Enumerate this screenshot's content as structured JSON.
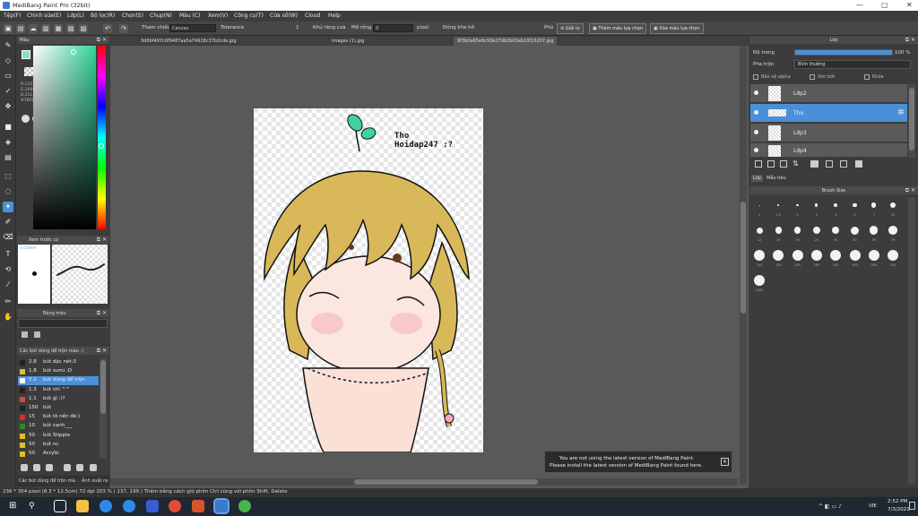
{
  "window": {
    "title": "MediBang Paint Pro (32bit)"
  },
  "menu": [
    "Tệp(F)",
    "Chỉnh sửa(E)",
    "Lớp(L)",
    "Bộ lọc(R)",
    "Chọn(S)",
    "Chụp(N)",
    "Màu (C)",
    "Xem(V)",
    "Công cụ(T)",
    "Cửa sổ(W)",
    "Cloud",
    "Help"
  ],
  "tool_options": {
    "reference_label": "Tham chiếu",
    "reference_value": "Canvas",
    "tolerance_label": "Tolerance",
    "tolerance_value": "1",
    "anti_alias_label": "Khử răng cưa",
    "expand_label": "Mở rộng",
    "expand_value": "0",
    "expand_unit": "pixel",
    "close_gaps_label": "Đóng khe hở",
    "close_gap_partial": "Phủ",
    "clear_button": "Giải lọ",
    "add_color_button": "Thêm màu lựa chọn",
    "remove_color_button": "Xóa màu lựa chọn"
  },
  "color_panel": {
    "title": "Màu",
    "r": "R:123",
    "g": "G:248",
    "b": "B:211",
    "hex": "#7BF8D3"
  },
  "brush_preview": {
    "title": "Xem trước cọ",
    "size": "1.03mm"
  },
  "color_set": {
    "title": "Bảng màu"
  },
  "brush_list": {
    "title": "Các bút dùng để trộn màu :)",
    "items": [
      {
        "size": "2.8",
        "name": "bút dặc nét:3",
        "color": "#222222"
      },
      {
        "size": "1.8",
        "name": "bút sumi :D",
        "color": "#d8c23a"
      },
      {
        "size": "5.2",
        "name": "bút dùng để trộn",
        "color": "#ffffff",
        "active": true
      },
      {
        "size": "1.3",
        "name": "bút chì ^^",
        "color": "#222222"
      },
      {
        "size": "1.1",
        "name": "bút gì :)?",
        "color": "#d04848"
      },
      {
        "size": "150",
        "name": "bút",
        "color": "#222222"
      },
      {
        "size": "15",
        "name": "bút tô nền đè:)",
        "color": "#d03030"
      },
      {
        "size": "10",
        "name": "bút cạnh___",
        "color": "#2a8a2a"
      },
      {
        "size": "50",
        "name": "bút Stipple",
        "color": "#e0c020"
      },
      {
        "size": "50",
        "name": "bút nc",
        "color": "#e0c020"
      },
      {
        "size": "50",
        "name": "Acrylic",
        "color": "#e0c020"
      }
    ]
  },
  "documents": {
    "tabs": [
      "3d0bf497c0f9487aa5a74918c37b2cde.jpg",
      "Images (1).jpg",
      "9f3b0a65e8c93e27db2b03eb18f15207.jpg"
    ]
  },
  "canvas_text": {
    "line1": "Tho",
    "line2": "Hoidap247 :?"
  },
  "notice": {
    "line1": "You are not using the latest version of MediBang Paint.",
    "line2": "Please install the latest version of MediBang Paint found here."
  },
  "layer_panel": {
    "title": "Lớp",
    "opacity_label": "Độ trong",
    "opacity_value": "100 %",
    "opacity_fraction": 1.0,
    "blend_label": "Pha trộn",
    "blend_value": "Bình thường",
    "protect_alpha": "Bảo vệ alpha",
    "clipping": "Xén bớt",
    "lock": "Khóa",
    "layers": [
      {
        "name": "Lớp2",
        "active": false
      },
      {
        "name": "Tho",
        "active": true
      },
      {
        "name": "Lớp3",
        "active": false
      },
      {
        "name": "Lớp4",
        "active": false
      }
    ],
    "tabs": [
      "Lớp",
      "Mẫu tiêu"
    ]
  },
  "brush_size": {
    "title": "Brush Size",
    "labels": [
      "1",
      "1.5",
      "2",
      "3",
      "4",
      "5",
      "7",
      "10",
      "12",
      "15",
      "20",
      "25",
      "30",
      "40",
      "50",
      "70",
      "100",
      "150",
      "200",
      "250",
      "300",
      "400",
      "500",
      "700",
      "1000"
    ]
  },
  "status": {
    "text": "236 * 354 pixel  (8.3 * 12.5cm)  72 dpi  203 %  ( 137, 199 )  Thêm bằng cách giữ phím Ctrl cùng với phím Shift, Delete",
    "bottom_tabs": [
      "Các bút dùng để trộn mà..",
      "Ảnh xuất ra"
    ]
  },
  "taskbar": {
    "time": "2:52 PM",
    "date": "7/3/2021",
    "lang": "VIE"
  }
}
